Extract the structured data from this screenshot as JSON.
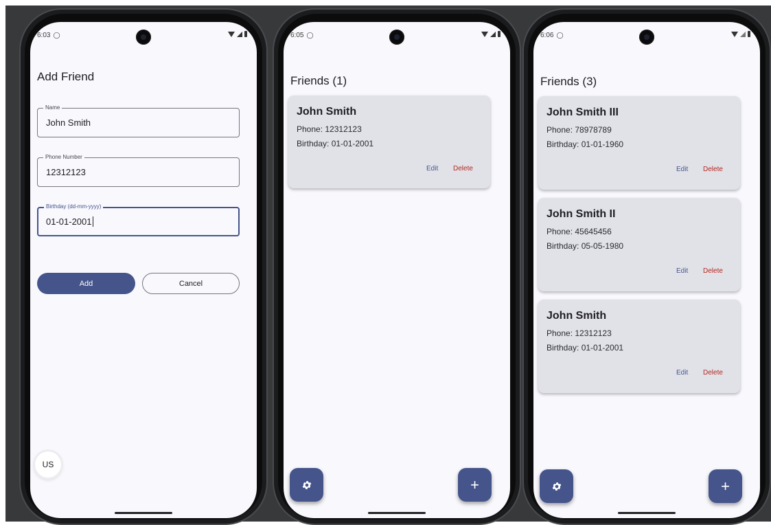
{
  "phones": [
    {
      "time": "6:03",
      "screen": "add_friend",
      "title": "Add Friend",
      "form": {
        "name_label": "Name",
        "name_value": "John Smith",
        "phone_label": "Phone Number",
        "phone_value": "12312123",
        "birthday_label": "Birthday (dd-mm-yyyy)",
        "birthday_value": "01-01-2001",
        "add_label": "Add",
        "cancel_label": "Cancel"
      },
      "language_button": "US"
    },
    {
      "time": "6:05",
      "screen": "friends_list",
      "title": "Friends (1)",
      "friends": [
        {
          "name": "John Smith",
          "phone": "Phone: 12312123",
          "birthday": "Birthday: 01-01-2001",
          "edit": "Edit",
          "delete": "Delete"
        }
      ],
      "fab_settings_icon": "gear-icon",
      "fab_add_icon": "plus-icon",
      "fab_add_glyph": "+"
    },
    {
      "time": "6:06",
      "screen": "friends_list",
      "title": "Friends (3)",
      "friends": [
        {
          "name": "John Smith III",
          "phone": "Phone: 78978789",
          "birthday": "Birthday: 01-01-1960",
          "edit": "Edit",
          "delete": "Delete"
        },
        {
          "name": "John Smith II",
          "phone": "Phone: 45645456",
          "birthday": "Birthday: 05-05-1980",
          "edit": "Edit",
          "delete": "Delete"
        },
        {
          "name": "John Smith",
          "phone": "Phone: 12312123",
          "birthday": "Birthday: 01-01-2001",
          "edit": "Edit",
          "delete": "Delete"
        }
      ],
      "fab_settings_icon": "gear-icon",
      "fab_add_icon": "plus-icon",
      "fab_add_glyph": "+"
    }
  ],
  "colors": {
    "primary": "#45548a",
    "delete": "#b3261e",
    "card": "#e1e2e8",
    "screen_bg": "#f8f8fd"
  }
}
